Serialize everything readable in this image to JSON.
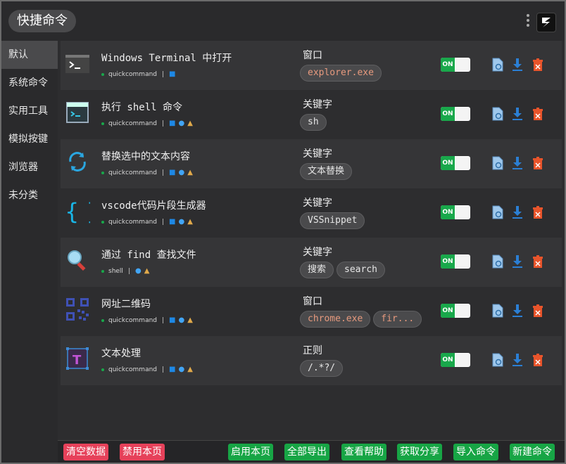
{
  "app": {
    "title": "快捷命令"
  },
  "sidebar": {
    "items": [
      {
        "label": "默认",
        "active": true
      },
      {
        "label": "系统命令",
        "active": false
      },
      {
        "label": "实用工具",
        "active": false
      },
      {
        "label": "模拟按键",
        "active": false
      },
      {
        "label": "浏览器",
        "active": false
      },
      {
        "label": "未分类",
        "active": false
      }
    ]
  },
  "commands": [
    {
      "title": "Windows Terminal 中打开",
      "source": "quickcommand",
      "platforms": [
        "win"
      ],
      "feature_type": "窗口",
      "tags": [
        "explorer.exe"
      ],
      "toggle": "ON",
      "icon": "terminal-icon"
    },
    {
      "title": "执行 shell 命令",
      "source": "quickcommand",
      "platforms": [
        "win",
        "mac",
        "linux"
      ],
      "feature_type": "关键字",
      "tags": [
        "sh"
      ],
      "toggle": "ON",
      "icon": "shell-window-icon"
    },
    {
      "title": "替换选中的文本内容",
      "source": "quickcommand",
      "platforms": [
        "win",
        "mac",
        "linux"
      ],
      "feature_type": "关键字",
      "tags": [
        "文本替换"
      ],
      "toggle": "ON",
      "icon": "replace-icon"
    },
    {
      "title": "vscode代码片段生成器",
      "source": "quickcommand",
      "platforms": [
        "win",
        "mac",
        "linux"
      ],
      "feature_type": "关键字",
      "tags": [
        "VSSnippet"
      ],
      "toggle": "ON",
      "icon": "braces-icon"
    },
    {
      "title": "通过 find 查找文件",
      "source": "shell",
      "platforms": [
        "mac",
        "linux"
      ],
      "feature_type": "关键字",
      "tags": [
        "搜索",
        "search"
      ],
      "toggle": "ON",
      "icon": "magnifier-icon"
    },
    {
      "title": "网址二维码",
      "source": "quickcommand",
      "platforms": [
        "win",
        "mac",
        "linux"
      ],
      "feature_type": "窗口",
      "tags": [
        "chrome.exe",
        "fir..."
      ],
      "toggle": "ON",
      "icon": "qrcode-icon"
    },
    {
      "title": "文本处理",
      "source": "quickcommand",
      "platforms": [
        "win",
        "mac",
        "linux"
      ],
      "feature_type": "正则",
      "tags": [
        "/.*?/"
      ],
      "toggle": "ON",
      "icon": "text-box-icon"
    }
  ],
  "footer": {
    "clear_data": "清空数据",
    "disable_page": "禁用本页",
    "enable_page": "启用本页",
    "export_all": "全部导出",
    "view_help": "查看帮助",
    "get_share": "获取分享",
    "import_cmd": "导入命令",
    "new_cmd": "新建命令"
  },
  "colors": {
    "accent_green": "#17a545",
    "danger_red": "#e6415a",
    "delete_orange": "#e8542b",
    "link_blue": "#1e88e5"
  }
}
